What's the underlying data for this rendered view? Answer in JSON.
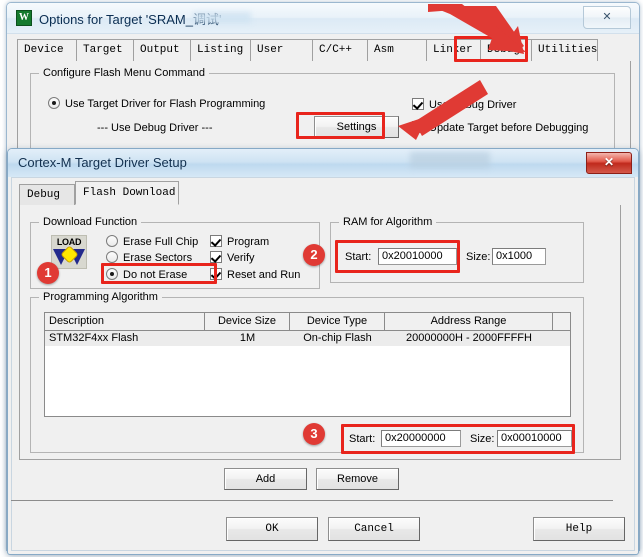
{
  "outer_dialog": {
    "title": "Options for Target 'SRAM_调试'",
    "app_icon": "keil-uvision-icon",
    "close_label": "✕",
    "tabs": [
      {
        "label": "Device",
        "selected": false
      },
      {
        "label": "Target",
        "selected": false
      },
      {
        "label": "Output",
        "selected": false
      },
      {
        "label": "Listing",
        "selected": false
      },
      {
        "label": "User",
        "selected": false
      },
      {
        "label": "C/C++",
        "selected": false
      },
      {
        "label": "Asm",
        "selected": false
      },
      {
        "label": "Linker",
        "selected": false
      },
      {
        "label": "Debug",
        "selected": false
      },
      {
        "label": "Utilities",
        "selected": true
      }
    ],
    "configure_flash": {
      "group_label": "Configure Flash Menu Command",
      "use_target_driver_label": "Use Target Driver for Flash Programming",
      "use_target_driver_checked": true,
      "driver_text": "--- Use Debug Driver ---",
      "settings_button": "Settings",
      "use_debug_driver_label": "Use Debug Driver",
      "use_debug_driver_checked": true,
      "update_target_label": "Update Target before Debugging",
      "update_target_checked": false
    }
  },
  "inner_dialog": {
    "title": "Cortex-M Target Driver Setup",
    "close_label": "✕",
    "tabs": [
      {
        "label": "Debug",
        "selected": false
      },
      {
        "label": "Flash Download",
        "selected": true
      }
    ],
    "download_function": {
      "group_label": "Download Function",
      "icon": "load-icon",
      "icon_text": "LOAD",
      "radios": [
        {
          "label": "Erase Full Chip",
          "checked": false
        },
        {
          "label": "Erase Sectors",
          "checked": false
        },
        {
          "label": "Do not Erase",
          "checked": true
        }
      ],
      "checkboxes": [
        {
          "label": "Program",
          "checked": true
        },
        {
          "label": "Verify",
          "checked": true
        },
        {
          "label": "Reset and Run",
          "checked": true
        }
      ]
    },
    "ram_for_algorithm": {
      "group_label": "RAM for Algorithm",
      "start_label": "Start:",
      "start_value": "0x20010000",
      "size_label": "Size:",
      "size_value": "0x1000"
    },
    "programming_algorithm": {
      "group_label": "Programming Algorithm",
      "columns": [
        "Description",
        "Device Size",
        "Device Type",
        "Address Range",
        ""
      ],
      "rows": [
        {
          "description": "STM32F4xx Flash",
          "device_size": "1M",
          "device_type": "On-chip Flash",
          "address_range": "20000000H - 2000FFFFH",
          "extra": ""
        }
      ],
      "start_label": "Start:",
      "start_value": "0x20000000",
      "size_label": "Size:",
      "size_value": "0x00010000",
      "add_button": "Add",
      "remove_button": "Remove"
    },
    "footer": {
      "ok_button": "OK",
      "cancel_button": "Cancel",
      "help_button": "Help"
    }
  },
  "annotations": {
    "markers": [
      {
        "number": "1",
        "target": "do-not-erase-radio"
      },
      {
        "number": "2",
        "target": "ram-algorithm-start-field"
      },
      {
        "number": "3",
        "target": "programming-algorithm-start-field"
      }
    ],
    "color": "#e8241c",
    "badge_color": "#e03a34",
    "arrows": [
      {
        "points_to": "utilities-tab"
      },
      {
        "points_to": "settings-button"
      }
    ]
  }
}
